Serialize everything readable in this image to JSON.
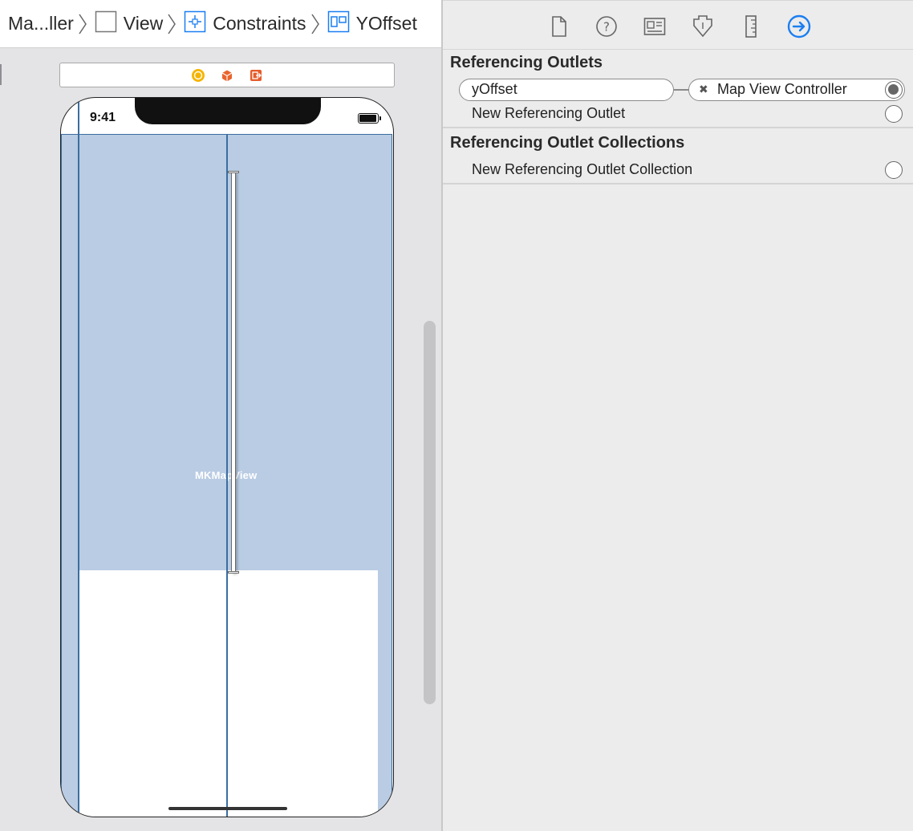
{
  "breadcrumb": [
    {
      "label": "Ma...ller",
      "icon": "view-controller-icon"
    },
    {
      "label": "View",
      "icon": "view-icon"
    },
    {
      "label": "Constraints",
      "icon": "constraints-icon"
    },
    {
      "label": "YOffset",
      "icon": "constraint-icon"
    }
  ],
  "scene_dock": {
    "icons": [
      "view-controller-icon",
      "first-responder-icon",
      "exit-icon"
    ],
    "colors": {
      "view_controller": "#f5b400",
      "first_responder": "#e8652e",
      "exit": "#e55b2a"
    }
  },
  "device": {
    "time": "9:41",
    "map_label": "MKMapView"
  },
  "inspector": {
    "tabs": [
      "file-inspector-icon",
      "quick-help-icon",
      "identity-inspector-icon",
      "attributes-inspector-icon",
      "size-inspector-icon",
      "connections-inspector-icon"
    ],
    "active_tab": "connections-inspector-icon",
    "referencing_outlets": {
      "title": "Referencing Outlets",
      "outlet": {
        "name": "yOffset",
        "target": "Map View Controller"
      },
      "new_label": "New Referencing Outlet"
    },
    "referencing_outlet_collections": {
      "title": "Referencing Outlet Collections",
      "new_label": "New Referencing Outlet Collection"
    }
  },
  "colors": {
    "map_fill": "#b9cce3",
    "selection": "#3b6ea0",
    "accent": "#1a7ef2"
  }
}
